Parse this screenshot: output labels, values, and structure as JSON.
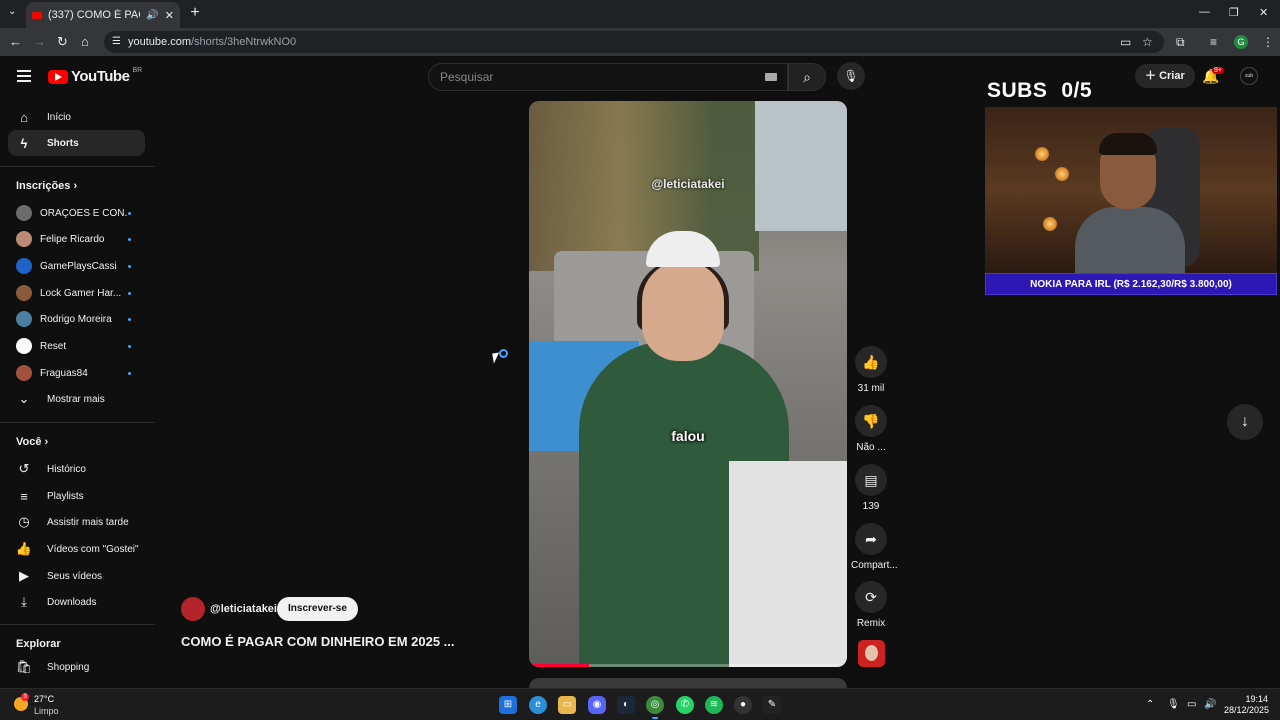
{
  "browser": {
    "tab_title": "(337) COMO É PAGAR COM",
    "url_host": "youtube.com",
    "url_path": "/shorts/3heNtrwkNO0"
  },
  "header": {
    "logo_text": "YouTube",
    "country_code": "BR",
    "search_placeholder": "Pesquisar",
    "create_label": "Criar",
    "notification_count": "9+"
  },
  "sidebar": {
    "main": [
      {
        "label": "Início",
        "icon": "home-icon"
      },
      {
        "label": "Shorts",
        "icon": "shorts-icon"
      }
    ],
    "subscriptions_title": "Inscrições",
    "subscriptions": [
      {
        "label": "ORAÇÕES E CON...",
        "color": "#6b6b6b"
      },
      {
        "label": "Felipe Ricardo",
        "color": "#b98a74"
      },
      {
        "label": "GamePlaysCassi",
        "color": "#1f62c9"
      },
      {
        "label": "Lock Gamer Har...",
        "color": "#8a5b3a"
      },
      {
        "label": "Rodrigo Moreira",
        "color": "#4a7fa0"
      },
      {
        "label": "Reset",
        "color": "#ffffff"
      },
      {
        "label": "Fraguas84",
        "color": "#a0523c"
      }
    ],
    "show_more": "Mostrar mais",
    "you_title": "Você",
    "you": [
      {
        "label": "Histórico"
      },
      {
        "label": "Playlists"
      },
      {
        "label": "Assistir mais tarde"
      },
      {
        "label": "Vídeos com \"Gostei\""
      },
      {
        "label": "Seus vídeos"
      },
      {
        "label": "Downloads"
      }
    ],
    "explore_title": "Explorar",
    "explore": [
      {
        "label": "Shopping"
      }
    ]
  },
  "short": {
    "watermark": "@leticiatakei",
    "caption": "falou",
    "progress": 0.19,
    "channel": "@leticiatakei",
    "subscribe_label": "Inscrever-se",
    "title": "COMO É PAGAR COM DINHEIRO EM 2025 ..."
  },
  "actions": {
    "like_count": "31 mil",
    "dislike_label": "Não ...",
    "comment_count": "139",
    "share_label": "Compart...",
    "remix_label": "Remix"
  },
  "overlay": {
    "subs_label": "SUBS",
    "subs_count": "0/5",
    "banner": "NOKIA PARA IRL (R$ 2.162,30/R$ 3.800,00)"
  },
  "taskbar": {
    "temperature": "27°C",
    "condition": "Limpo",
    "weather_badge": "3",
    "time": "19:14",
    "date": "28/12/2025"
  }
}
